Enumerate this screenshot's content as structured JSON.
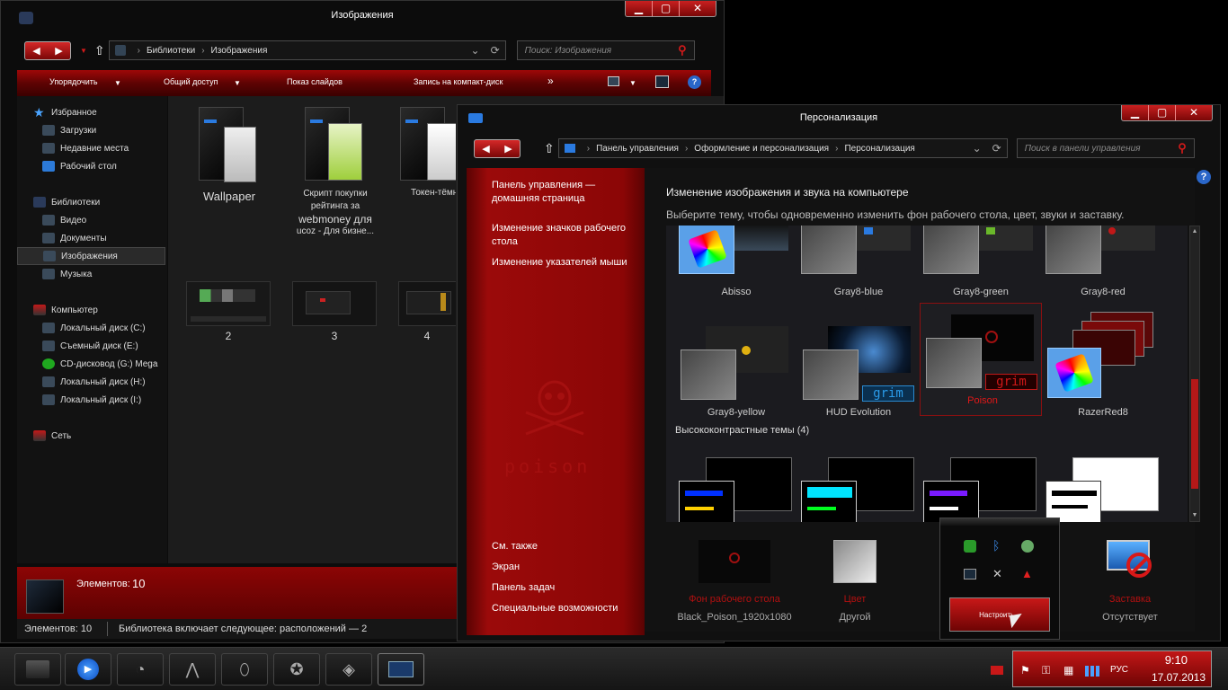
{
  "explorer": {
    "title": "Изображения",
    "breadcrumb": [
      "Библиотеки",
      "Изображения"
    ],
    "search_placeholder": "Поиск: Изображения",
    "toolbar": {
      "organize": "Упорядочить",
      "share": "Общий доступ",
      "slideshow": "Показ слайдов",
      "burn": "Запись на компакт-диск",
      "more": "»"
    },
    "sidebar": {
      "favorites": "Избранное",
      "downloads": "Загрузки",
      "recent": "Недавние места",
      "desktop": "Рабочий стол",
      "libraries": "Библиотеки",
      "video": "Видео",
      "documents": "Документы",
      "pictures": "Изображения",
      "music": "Музыка",
      "computer": "Компьютер",
      "drive_c": "Локальный диск (C:)",
      "drive_e": "Съемный диск (E:)",
      "drive_g": "CD-дисковод (G:) Mega",
      "drive_h": "Локальный диск (H:)",
      "drive_i": "Локальный диск (I:)",
      "network": "Сеть"
    },
    "items": {
      "wallpaper": "Wallpaper",
      "script_l1": "Скрипт покупки",
      "script_l2": "рейтинга за",
      "script_l3": "webmoney для",
      "script_l4": "ucoz - Для бизне...",
      "token": "Токен-тёмн",
      "img2": "2",
      "img3": "3",
      "img4": "4"
    },
    "details_label": "Элементов:",
    "details_count": "10",
    "status_count": "Элементов: 10",
    "status_library": "Библиотека включает следующее: расположений — 2"
  },
  "personalization": {
    "title": "Персонализация",
    "breadcrumb": [
      "Панель управления",
      "Оформление и персонализация",
      "Персонализация"
    ],
    "search_placeholder": "Поиск в панели управления",
    "left": {
      "home_l1": "Панель управления —",
      "home_l2": "домашняя страница",
      "icons_l1": "Изменение значков рабочего",
      "icons_l2": "стола",
      "pointers": "Изменение указателей мыши",
      "see_also": "См. также",
      "screen": "Экран",
      "taskbar": "Панель задач",
      "accessibility": "Специальные возможности",
      "logo_text": "poison"
    },
    "heading": "Изменение изображения и звука на компьютере",
    "subheading": "Выберите тему, чтобы одновременно изменить фон рабочего стола, цвет, звуки и заставку.",
    "themes_row1": [
      "Abisso",
      "Gray8-blue",
      "Gray8-green",
      "Gray8-red"
    ],
    "themes_row2": [
      "Gray8-yellow",
      "HUD Evolution",
      "Poison",
      "RazerRed8"
    ],
    "grim_label": "grim",
    "high_contrast": "Высококонтрастные темы (4)",
    "bottom": {
      "bg_label": "Фон рабочего стола",
      "bg_value": "Black_Poison_1920x1080",
      "color_label": "Цвет",
      "color_value": "Другой",
      "saver_label": "Заставка",
      "saver_value": "Отсутствует"
    },
    "popup_button": "Настроить..."
  },
  "taskbar": {
    "time": "9:10",
    "date": "17.07.2013",
    "lang": "РУС"
  },
  "colors": {
    "accent": "#b00a0a",
    "selected_theme_label": "#e01818"
  }
}
